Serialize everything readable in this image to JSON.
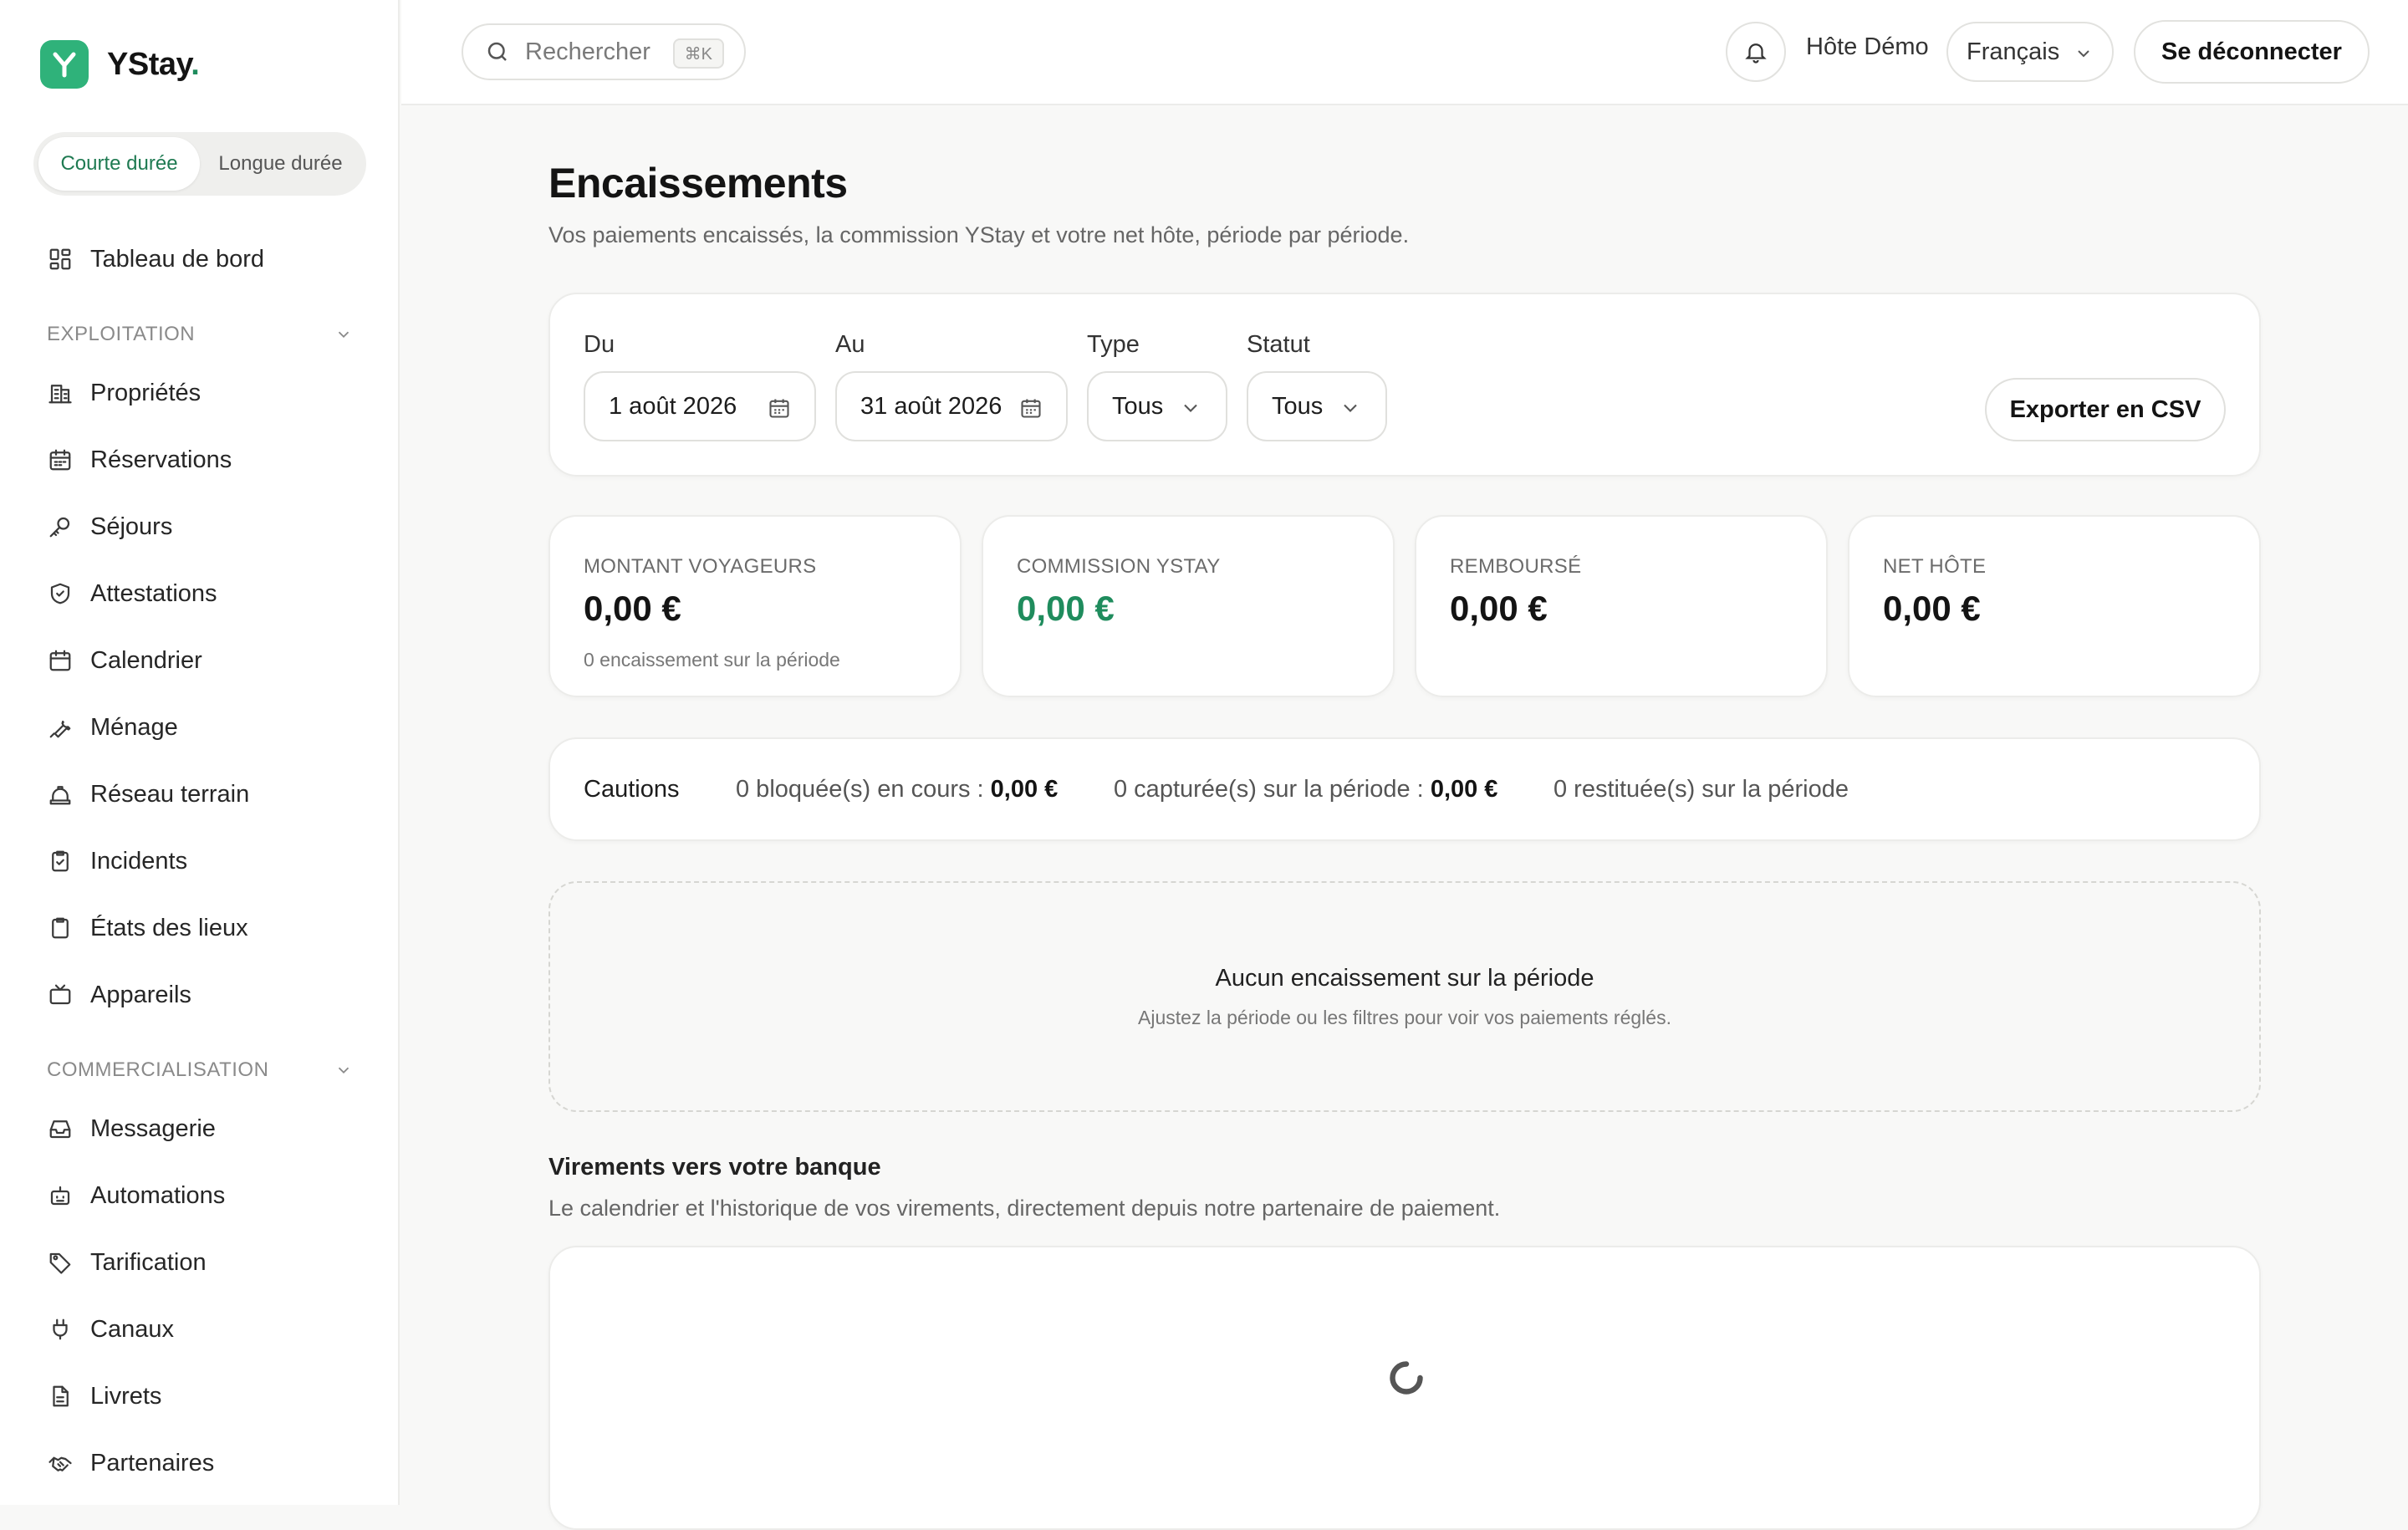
{
  "brand": {
    "name": "YStay",
    "dot": ".",
    "logo_letter": "Y",
    "accent": "#2fb27a"
  },
  "mode": {
    "options": [
      "Courte durée",
      "Longue durée"
    ],
    "active": "Courte durée"
  },
  "nav": {
    "dashboard": "Tableau de bord",
    "sections": [
      {
        "title": "EXPLOITATION",
        "items": [
          "Propriétés",
          "Réservations",
          "Séjours",
          "Attestations",
          "Calendrier",
          "Ménage",
          "Réseau terrain",
          "Incidents",
          "États des lieux",
          "Appareils"
        ]
      },
      {
        "title": "COMMERCIALISATION",
        "items": [
          "Messagerie",
          "Automations",
          "Tarification",
          "Canaux",
          "Livrets",
          "Partenaires"
        ]
      }
    ]
  },
  "topbar": {
    "search_placeholder": "Rechercher",
    "search_shortcut": "⌘K",
    "host": "Hôte Démo",
    "language": "Français",
    "logout": "Se déconnecter"
  },
  "page": {
    "title": "Encaissements",
    "subtitle": "Vos paiements encaissés, la commission YStay et votre net hôte, période par période."
  },
  "filters": {
    "from_label": "Du",
    "from_value": "1 août 2026",
    "to_label": "Au",
    "to_value": "31 août 2026",
    "type_label": "Type",
    "type_value": "Tous",
    "status_label": "Statut",
    "status_value": "Tous",
    "export": "Exporter en CSV"
  },
  "stats": [
    {
      "label": "MONTANT VOYAGEURS",
      "value": "0,00 €",
      "note": "0 encaissement sur la période"
    },
    {
      "label": "COMMISSION YSTAY",
      "value": "0,00 €",
      "color": "#1f8c5d"
    },
    {
      "label": "REMBOURSÉ",
      "value": "0,00 €"
    },
    {
      "label": "NET HÔTE",
      "value": "0,00 €"
    }
  ],
  "cautions": {
    "title": "Cautions",
    "blocked_text": "0 bloquée(s) en cours : ",
    "blocked_amount": "0,00 €",
    "captured_text": "0 capturée(s) sur la période : ",
    "captured_amount": "0,00 €",
    "returned_text": "0 restituée(s) sur la période"
  },
  "empty": {
    "title": "Aucun encaissement sur la période",
    "subtitle": "Ajustez la période ou les filtres pour voir vos paiements réglés."
  },
  "transfers": {
    "title": "Virements vers votre banque",
    "subtitle": "Le calendrier et l'historique de vos virements, directement depuis notre partenaire de paiement."
  }
}
